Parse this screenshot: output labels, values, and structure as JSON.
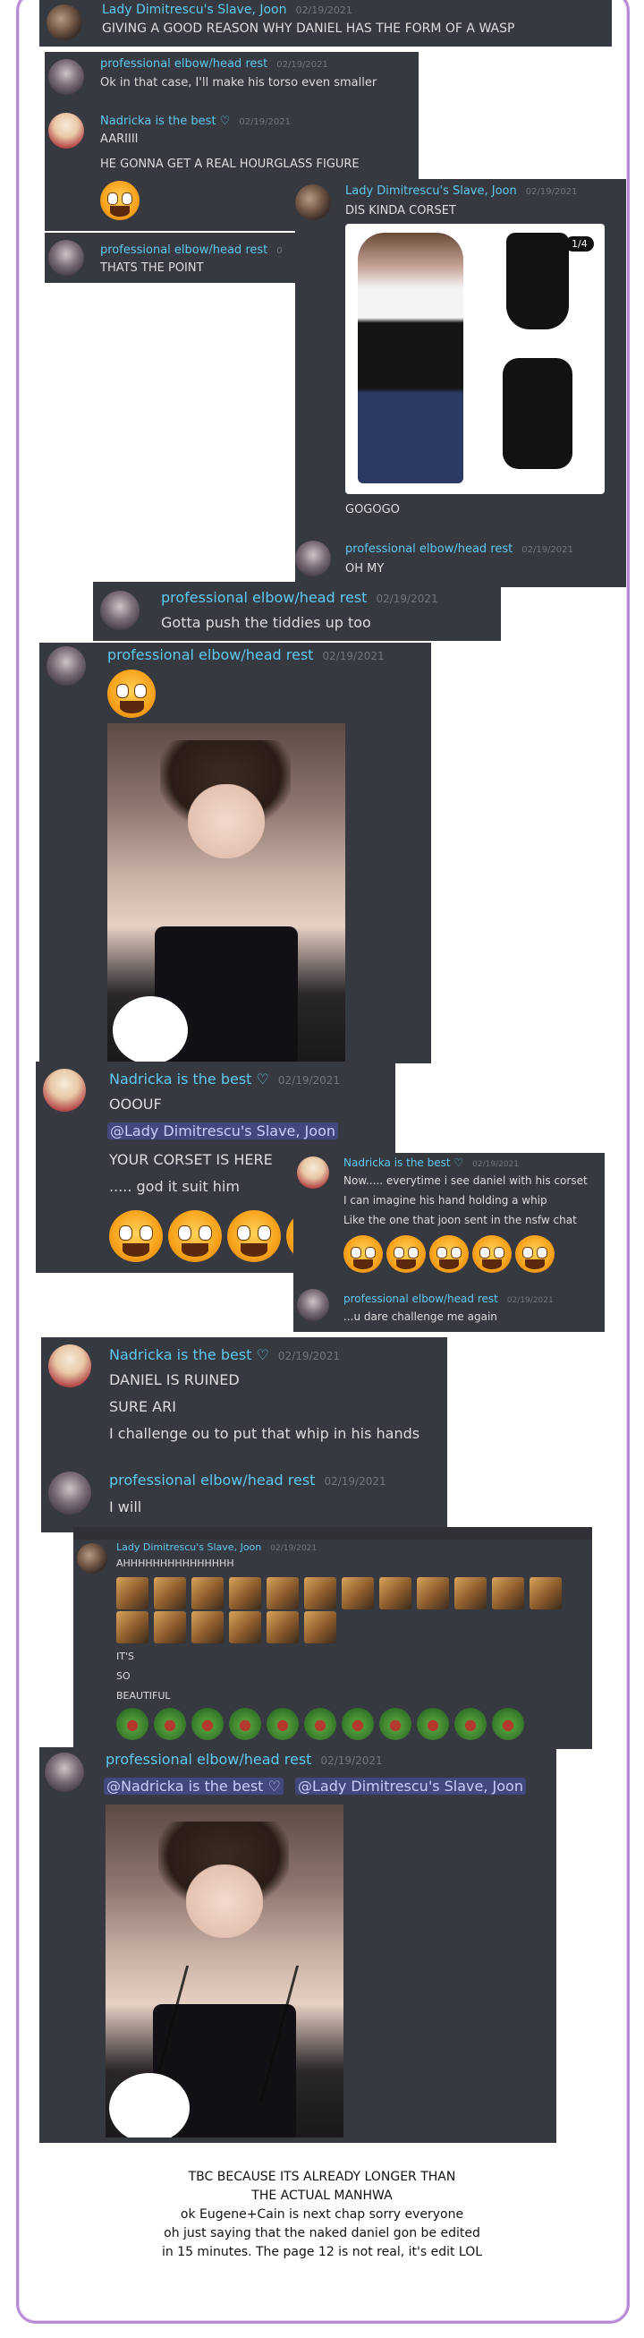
{
  "users": {
    "joon": "Lady Dimitrescu's Slave, Joon",
    "pro": "professional elbow/head rest",
    "nad": "Nadricka is the best ♡"
  },
  "date": "02/19/2021",
  "date_partial": "0",
  "messages": {
    "m1": "GIVING A GOOD REASON WHY DANIEL HAS THE FORM OF A WASP",
    "m2": "Ok in that case, I'll make his torso even smaller",
    "m3a": "AARIIII",
    "m3b": "HE GONNA GET A REAL HOURGLASS FIGURE",
    "m4": "DIS KINDA CORSET",
    "m5": "THATS THE POINT",
    "m6": "GOGOGO",
    "m7": "OH MY",
    "m8": "Gotta push the tiddies up too",
    "m10a": "OOOUF",
    "m10b": "@Lady Dimitrescu's Slave, Joon",
    "m10c": "YOUR CORSET IS HERE",
    "m10d": "..... god it suit him",
    "m11a": "Now..... everytime i see daniel with his corset",
    "m11b": "I can imagine his hand holding a whip",
    "m11c": "Like the one that joon sent in the nsfw chat",
    "m12": "...u dare challenge me again",
    "m13a": "DANIEL IS RUINED",
    "m13b": "SURE ARI",
    "m13c": "I challenge ou to put that whip in his hands",
    "m14": "I will",
    "m15a": "AHHHHHHHHHHHHHHH",
    "m15b": "IT'S",
    "m15c": "SO",
    "m15d": "BEAUTIFUL",
    "m16a": "@Nadricka is the best ♡",
    "m16b": "@Lady Dimitrescu's Slave, Joon"
  },
  "image_badge": "1/4",
  "caption": [
    "TBC BECAUSE ITS ALREADY LONGER THAN",
    "THE ACTUAL MANHWA",
    "ok Eugene+Cain is next chap sorry everyone",
    "oh just saying that the naked daniel gon be edited",
    "in 15 minutes. The page 12 is not real, it's edit LOL"
  ],
  "colors": {
    "panel_bg": "#36393f",
    "name": "#5ec8f0",
    "text": "#dcddde",
    "timestamp": "#72767d",
    "frame": "#b98ad6"
  }
}
